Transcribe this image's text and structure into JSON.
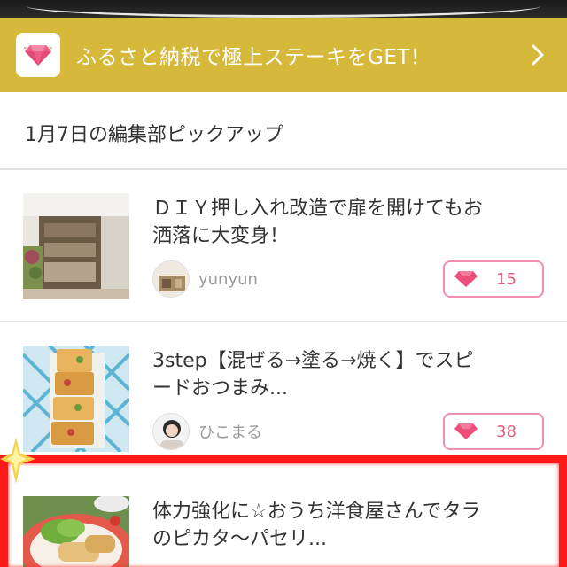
{
  "banner": {
    "text": "ふるさと納税で極上ステーキをGET！",
    "icon": "diamond-icon",
    "chevron": "chevron-right-icon"
  },
  "section": {
    "title": "1月7日の編集部ピックアップ"
  },
  "items": [
    {
      "title_line1": "ＤＩＹ押し入れ改造で扉を開けてもお",
      "title_line2": "洒落に大変身！",
      "author": "yunyun",
      "likes": "15"
    },
    {
      "title_line1": "3step【混ぜる→塗る→焼く】でスピ",
      "title_line2": "ードおつまみ...",
      "author": "ひこまる",
      "likes": "38"
    },
    {
      "title_line1": "体力強化に☆おうち洋食屋さんでタラ",
      "title_line2": "のピカタ〜パセリ..."
    }
  ],
  "colors": {
    "banner": "#d6b93a",
    "like_border": "#f08fab",
    "like_text": "#e4607f",
    "highlight_frame": "#ff1a1a"
  }
}
